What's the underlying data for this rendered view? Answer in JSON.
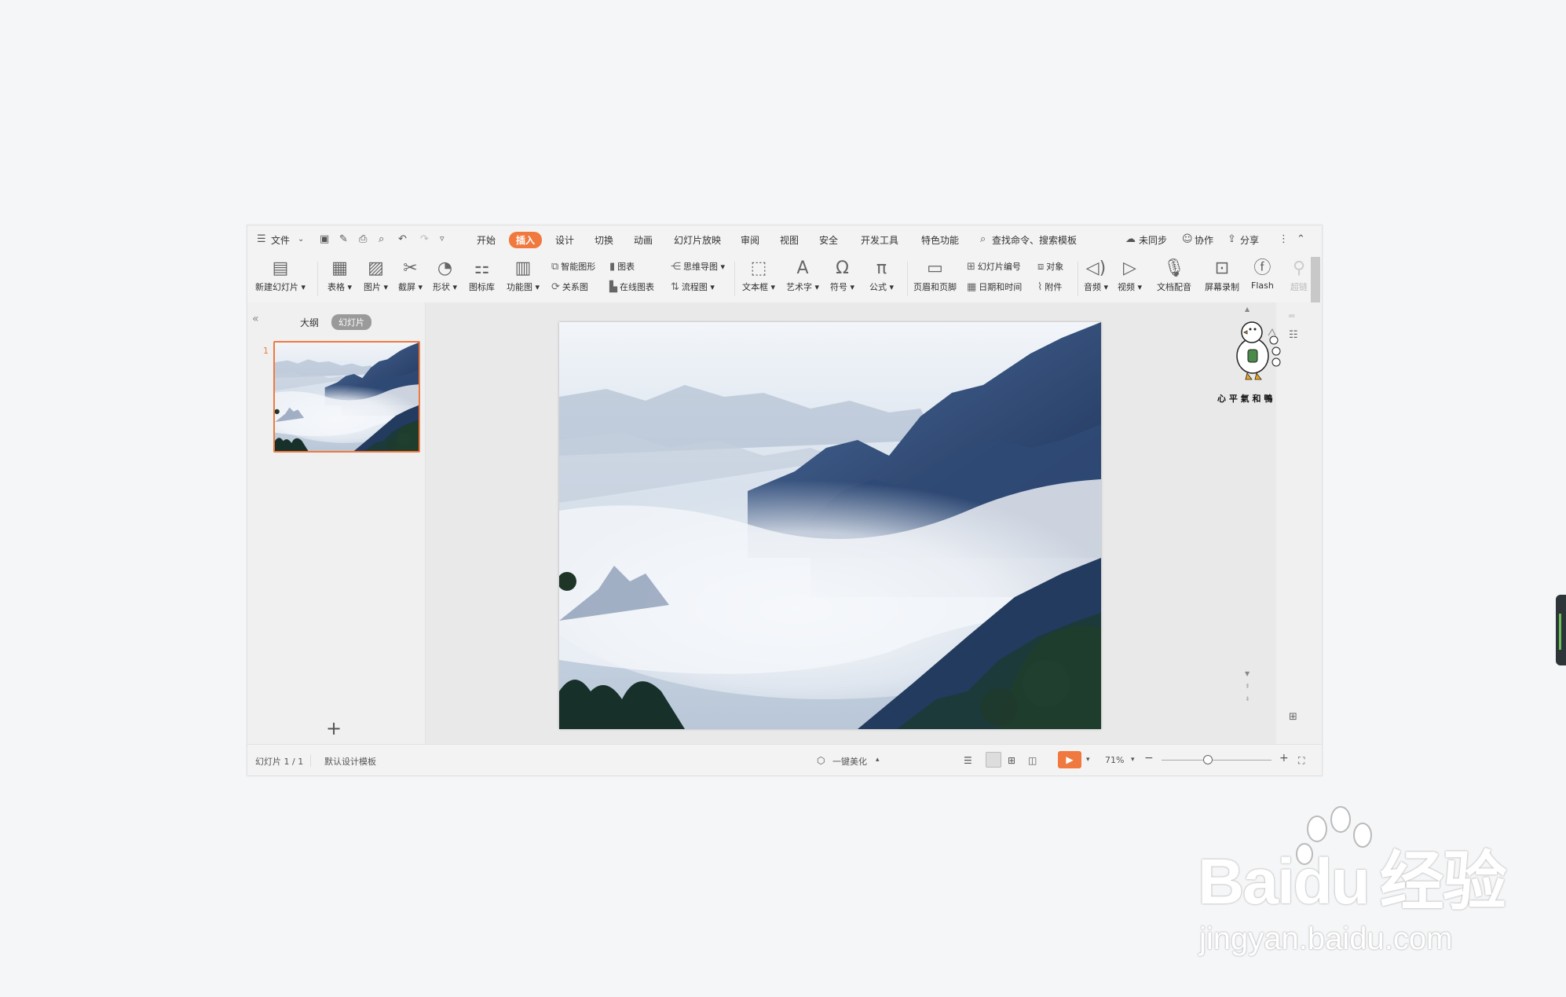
{
  "menu": {
    "file": "文件",
    "tabs": [
      "开始",
      "插入",
      "设计",
      "切换",
      "动画",
      "幻灯片放映",
      "审阅",
      "视图",
      "安全",
      "开发工具",
      "特色功能"
    ],
    "active_tab": "插入",
    "search": "查找命令、搜索模板",
    "sync": "未同步",
    "collab": "协作",
    "share": "分享"
  },
  "ribbon": {
    "new_slide": "新建幻灯片",
    "table": "表格",
    "picture": "图片",
    "screenshot": "截屏",
    "shape": "形状",
    "icon_lib": "图标库",
    "func_chart": "功能图",
    "smart_shape": "智能图形",
    "chart": "图表",
    "relation": "关系图",
    "online_chart": "在线图表",
    "mindmap": "思维导图",
    "flowchart": "流程图",
    "textbox": "文本框",
    "wordart": "艺术字",
    "symbol": "符号",
    "formula": "公式",
    "header_footer": "页眉和页脚",
    "slide_number": "幻灯片编号",
    "object": "对象",
    "datetime": "日期和时间",
    "attachment": "附件",
    "audio": "音频",
    "video": "视频",
    "doc_dub": "文档配音",
    "screen_record": "屏幕录制",
    "flash": "Flash",
    "hyperlink": "超链"
  },
  "panel": {
    "tab_outline": "大纲",
    "tab_slides": "幻灯片",
    "slide_num": "1",
    "add_icon": "+"
  },
  "sticker": {
    "caption": "心 平 氣 和 鴨"
  },
  "status": {
    "slide_info": "幻灯片 1 / 1",
    "template": "默认设计模板",
    "beautify": "一键美化",
    "zoom": "71%",
    "zoom_fraction": 0.42
  },
  "watermark": {
    "brand": "Bai",
    "brand2": "du",
    "cn": "经验",
    "url": "jingyan.baidu.com"
  },
  "colors": {
    "accent": "#f0793f"
  }
}
